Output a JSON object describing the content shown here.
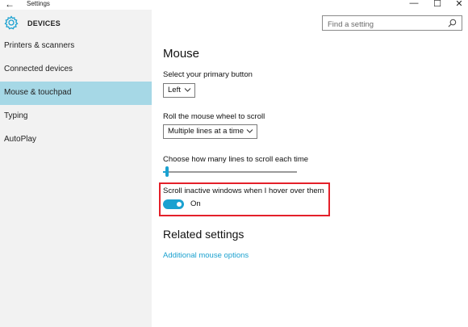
{
  "window": {
    "title": "Settings",
    "back_glyph": "←",
    "minimize_glyph": "—",
    "maximize_glyph": "☐",
    "close_glyph": "✕"
  },
  "sidebar": {
    "section_title": "DEVICES",
    "items": [
      {
        "label": "Printers & scanners",
        "active": false
      },
      {
        "label": "Connected devices",
        "active": false
      },
      {
        "label": "Mouse & touchpad",
        "active": true
      },
      {
        "label": "Typing",
        "active": false
      },
      {
        "label": "AutoPlay",
        "active": false
      }
    ]
  },
  "search": {
    "placeholder": "Find a setting",
    "value": ""
  },
  "main": {
    "title": "Mouse",
    "primary_button": {
      "label": "Select your primary button",
      "value": "Left"
    },
    "scroll_wheel": {
      "label": "Roll the mouse wheel to scroll",
      "value": "Multiple lines at a time"
    },
    "lines_slider": {
      "label": "Choose how many lines to scroll each time",
      "value_fraction": 0.03
    },
    "inactive_scroll": {
      "label": "Scroll inactive windows when I hover over them",
      "state": "On",
      "enabled": true
    },
    "related_title": "Related settings",
    "related_link": "Additional mouse options"
  },
  "colors": {
    "accent": "#1aa1d0",
    "sidebar_bg": "#f2f2f2",
    "active_item_bg": "#a6d8e6",
    "highlight_border": "#e4202a",
    "link": "#1ba1cf"
  },
  "icons": {
    "back": "back-arrow-icon",
    "settings": "gear-icon",
    "search": "search-icon",
    "dropdown": "chevron-down-icon"
  }
}
